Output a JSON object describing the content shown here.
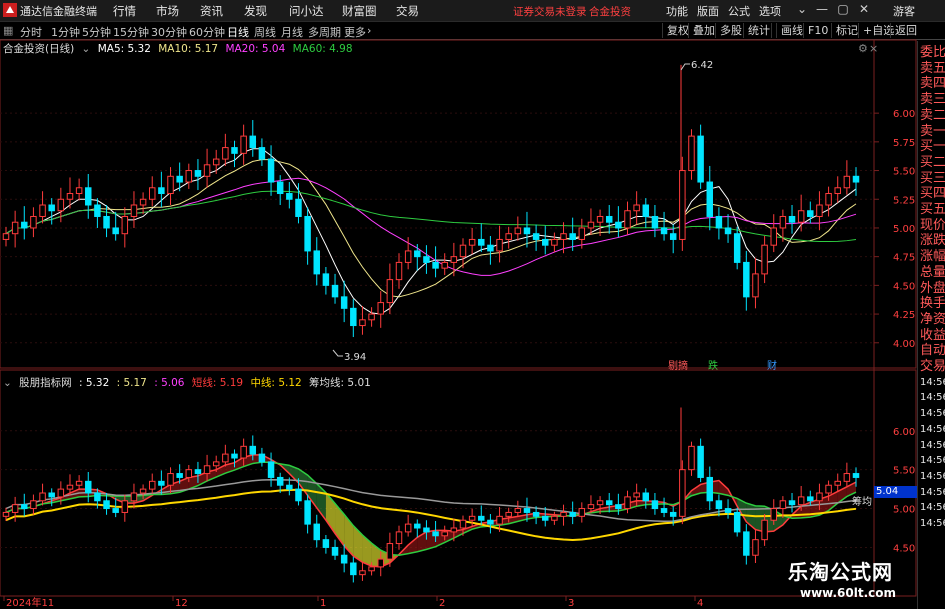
{
  "app": {
    "title": "通达信金融终端"
  },
  "menu": [
    "行情",
    "市场",
    "资讯",
    "发现",
    "问小达",
    "财富圈",
    "交易"
  ],
  "warning": {
    "text1": "证券交易未登录",
    "text2": "合金投资"
  },
  "top_right": [
    "功能",
    "版面",
    "公式",
    "选项",
    "游客"
  ],
  "periods": [
    "分时",
    "1分钟",
    "5分钟",
    "15分钟",
    "30分钟",
    "60分钟",
    "日线",
    "周线",
    "月线",
    "多周期",
    "更多"
  ],
  "active_period": "日线",
  "tools": [
    "复权",
    "叠加",
    "多股",
    "统计",
    "画线",
    "F10",
    "标记",
    "+自选",
    "返回"
  ],
  "main_info": {
    "stock": "合金投资(日线)",
    "ma5": "MA5: 5.32",
    "ma10": "MA10: 5.17",
    "ma20": "MA20: 5.04",
    "ma60": "MA60: 4.98"
  },
  "sub_info": {
    "name": "股朋指标网",
    "v1": ": 5.32",
    "v2": ": 5.17",
    "v3": ": 5.06",
    "short": "短线: 5.19",
    "mid": "中线: 5.12",
    "chip": "筹均线: 5.01"
  },
  "right_panel": [
    "委比",
    "卖五",
    "卖四",
    "卖三",
    "卖二",
    "卖一",
    "买一",
    "买二",
    "买三",
    "买四",
    "买五",
    "现价",
    "涨跌",
    "涨幅",
    "总量",
    "外盘",
    "换手",
    "净资",
    "收益",
    "自动",
    "交易",
    "14:56",
    "14:56",
    "14:56",
    "14:56",
    "14:56",
    "14:56",
    "14:56",
    "14:56",
    "14:56",
    "14:56"
  ],
  "y_axis_main": [
    "6.00",
    "5.75",
    "5.50",
    "5.25",
    "5.00",
    "4.75",
    "4.50",
    "4.25",
    "4.00"
  ],
  "y_axis_sub": [
    "6.00",
    "5.50",
    "5.00",
    "4.50"
  ],
  "x_axis": [
    "2024年11",
    "12",
    "1",
    "2",
    "3",
    "4"
  ],
  "annotations": {
    "high": "6.42",
    "low": "3.94",
    "chip_label": "筹均"
  },
  "event_tags": [
    "剔摘",
    "跌",
    "财"
  ],
  "price_tag": "5.04",
  "watermark": {
    "cn": "乐淘公式网",
    "url": "www.60lt.com"
  },
  "colors": {
    "up": "#ff3c3c",
    "down": "#00e5ff",
    "ma5": "#ffffff",
    "ma10": "#f0e68c",
    "ma20": "#ff40ff",
    "ma60": "#2ecc40"
  },
  "chart_data": {
    "type": "candlestick",
    "ylim": [
      3.85,
      6.55
    ],
    "closes": [
      4.95,
      5.05,
      5.0,
      5.1,
      5.2,
      5.15,
      5.25,
      5.3,
      5.35,
      5.2,
      5.1,
      5.0,
      4.95,
      5.1,
      5.2,
      5.25,
      5.35,
      5.3,
      5.45,
      5.4,
      5.5,
      5.45,
      5.55,
      5.6,
      5.7,
      5.65,
      5.8,
      5.7,
      5.6,
      5.4,
      5.3,
      5.25,
      5.1,
      4.8,
      4.6,
      4.5,
      4.4,
      4.3,
      4.15,
      4.2,
      4.25,
      4.35,
      4.55,
      4.7,
      4.8,
      4.75,
      4.7,
      4.65,
      4.7,
      4.75,
      4.85,
      4.9,
      4.85,
      4.8,
      4.9,
      4.95,
      5.0,
      4.95,
      4.9,
      4.85,
      4.9,
      4.95,
      4.9,
      5.0,
      5.05,
      5.1,
      5.05,
      5.0,
      5.15,
      5.2,
      5.1,
      5.0,
      4.95,
      4.9,
      5.5,
      5.8,
      5.4,
      5.1,
      5.0,
      4.95,
      4.7,
      4.4,
      4.6,
      4.85,
      5.0,
      5.1,
      5.05,
      5.15,
      5.1,
      5.2,
      5.3,
      5.35,
      5.45,
      5.4
    ]
  }
}
